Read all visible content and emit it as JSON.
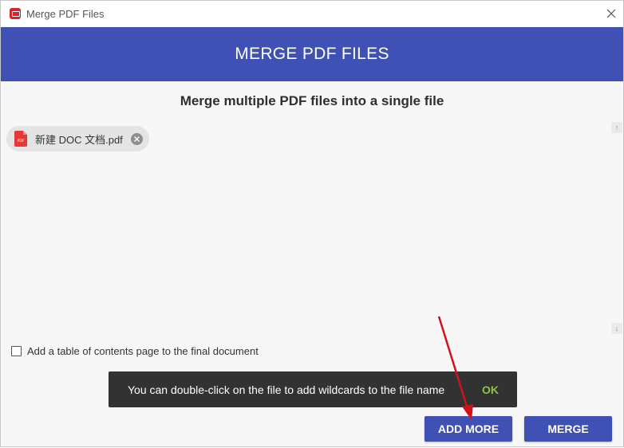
{
  "window": {
    "title": "Merge PDF Files"
  },
  "header": {
    "title": "MERGE PDF FILES"
  },
  "main": {
    "subtitle": "Merge multiple PDF files into a single file",
    "files": [
      {
        "name": "新建 DOC 文档.pdf"
      }
    ],
    "toc_option": {
      "label": "Add a table of contents page to the final document",
      "checked": false
    }
  },
  "toast": {
    "message": "You can double-click on the file to add wildcards to the file name",
    "action": "OK"
  },
  "actions": {
    "add_more": "ADD MORE",
    "merge": "MERGE"
  },
  "colors": {
    "accent": "#3f51b5",
    "pdf_red": "#e53935",
    "toast_bg": "#323232",
    "toast_action": "#8bc34a",
    "annotation_arrow": "#d0131b"
  },
  "icons": [
    "app-logo-icon",
    "close-icon",
    "pdf-file-icon",
    "remove-file-icon",
    "scroll-up-icon",
    "scroll-down-icon"
  ]
}
